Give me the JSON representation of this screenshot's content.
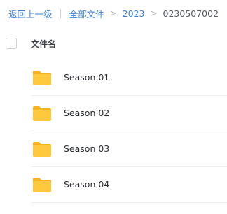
{
  "breadcrumb": {
    "back_label": "返回上一级",
    "divider": "|",
    "items": [
      {
        "label": "全部文件"
      },
      {
        "label": "2023"
      }
    ],
    "separator": ">",
    "current": "0230507002"
  },
  "table": {
    "column_name": "文件名"
  },
  "files": [
    {
      "name": "Season 01",
      "icon": "folder-icon"
    },
    {
      "name": "Season 02",
      "icon": "folder-icon"
    },
    {
      "name": "Season 03",
      "icon": "folder-icon"
    },
    {
      "name": "Season 04",
      "icon": "folder-icon"
    }
  ],
  "colors": {
    "link": "#3b82d6",
    "folder": "#ffc83d",
    "folder_tab": "#f5b324"
  }
}
